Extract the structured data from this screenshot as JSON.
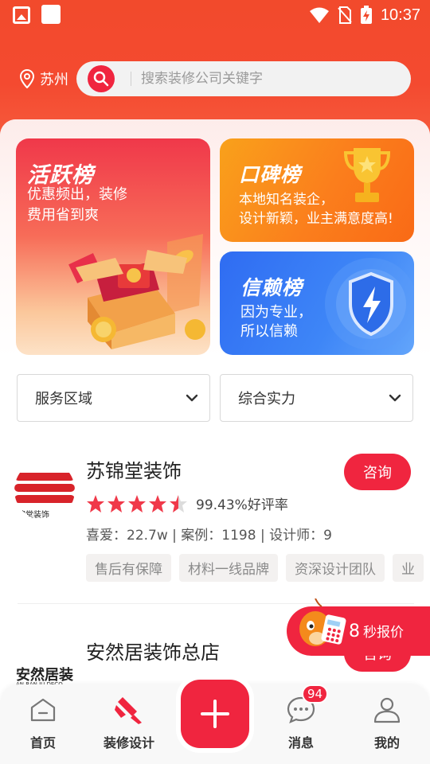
{
  "status_bar": {
    "time": "10:37"
  },
  "header": {
    "city": "苏州",
    "search_placeholder": "搜索装修公司关键字"
  },
  "banners": {
    "active": {
      "title": "活跃榜",
      "subtitle_line1": "优惠频出，装修",
      "subtitle_line2": "费用省到爽"
    },
    "reputation": {
      "title": "口碑榜",
      "subtitle_line1": "本地知名装企，",
      "subtitle_line2": "设计新颖，业主满意度高!"
    },
    "trust": {
      "title": "信赖榜",
      "subtitle_line1": "因为专业，",
      "subtitle_line2": "所以信赖"
    }
  },
  "filters": {
    "area": "服务区域",
    "strength": "综合实力"
  },
  "companies": [
    {
      "name": "苏锦堂装饰",
      "consult": "咨询",
      "rating_stars": 4.5,
      "rating_text": "99.43%好评率",
      "stats": "喜爱：22.7w | 案例：1198 | 设计师：9",
      "tags": [
        "售后有保障",
        "材料一线品牌",
        "资深设计团队",
        "业"
      ],
      "logo_text": "锦堂装饰"
    },
    {
      "name": "安然居装饰总店",
      "consult": "咨询",
      "logo_text": "安然居装",
      "logo_sub": "AN RAN JU DECO"
    }
  ],
  "quote": {
    "number": "8",
    "text": "秒报价"
  },
  "nav": {
    "home": "首页",
    "design": "装修设计",
    "messages": "消息",
    "mine": "我的",
    "badge": "94"
  },
  "colors": {
    "primary": "#f0253f",
    "header": "#f24a2c",
    "star": "#f0394a"
  }
}
